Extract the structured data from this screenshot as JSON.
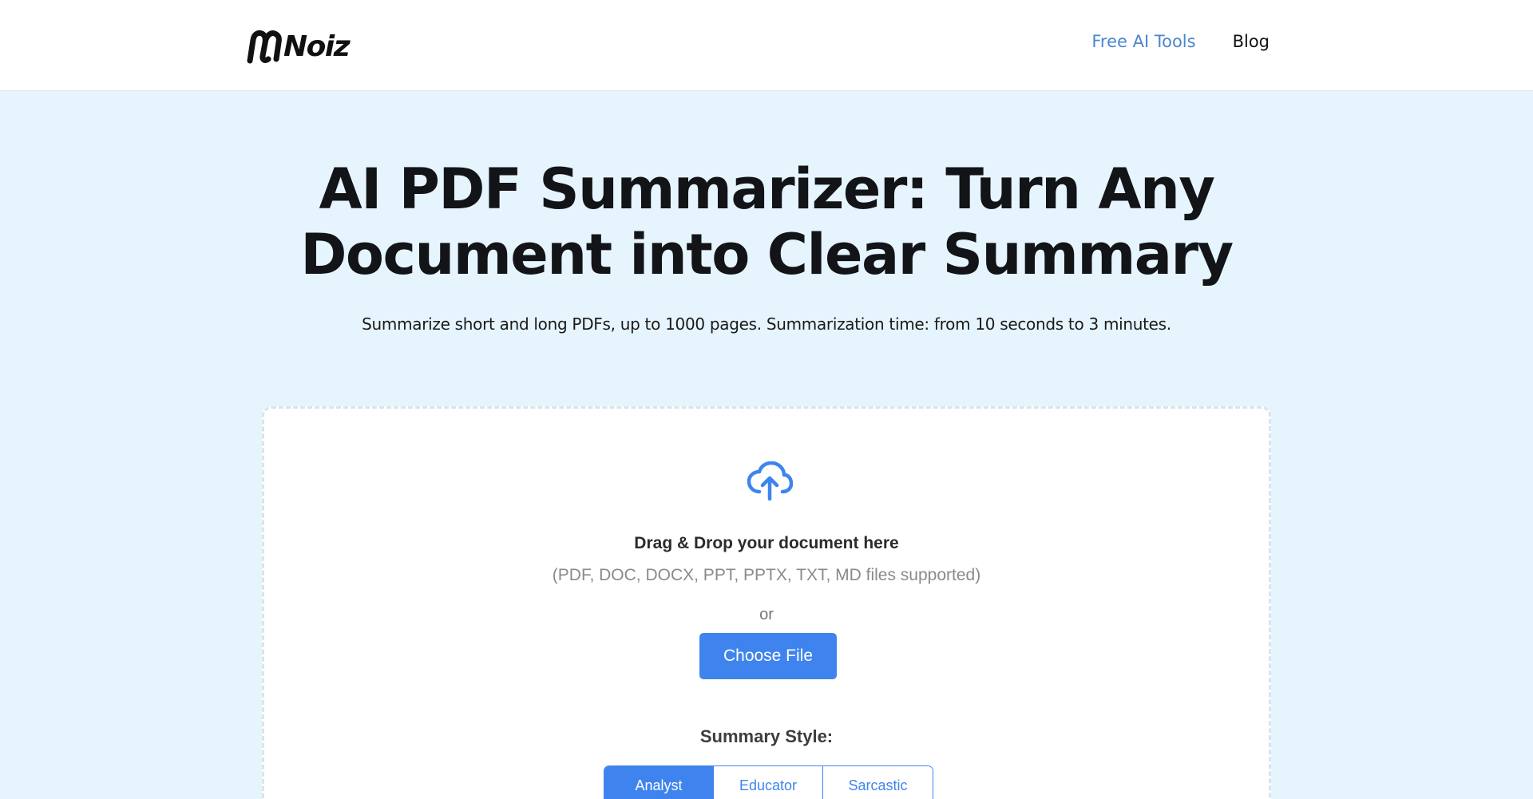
{
  "brand": {
    "name": "Noiz",
    "color": "#111111"
  },
  "nav": {
    "items": [
      {
        "label": "Free AI Tools",
        "color": "#4a86d0"
      },
      {
        "label": "Blog",
        "color": "#111111"
      }
    ]
  },
  "hero": {
    "title": "AI PDF Summarizer: Turn Any Document into Clear Summary",
    "subtitle": "Summarize short and long PDFs, up to 1000 pages. Summarization time: from 10 seconds to 3 minutes."
  },
  "upload": {
    "icon": "cloud-upload-icon",
    "drag_text": "Drag & Drop your document here",
    "formats_text": "(PDF, DOC, DOCX, PPT, PPTX, TXT, MD files supported)",
    "or_text": "or",
    "button_label": "Choose File",
    "accent_color": "#3f84ee"
  },
  "summary_style": {
    "label": "Summary Style:",
    "options": [
      {
        "label": "Analyst",
        "selected": true
      },
      {
        "label": "Educator",
        "selected": false
      },
      {
        "label": "Sarcastic",
        "selected": false
      }
    ]
  },
  "colors": {
    "page_background": "#e6f4fd",
    "header_background": "#ffffff",
    "card_background": "#ffffff"
  }
}
